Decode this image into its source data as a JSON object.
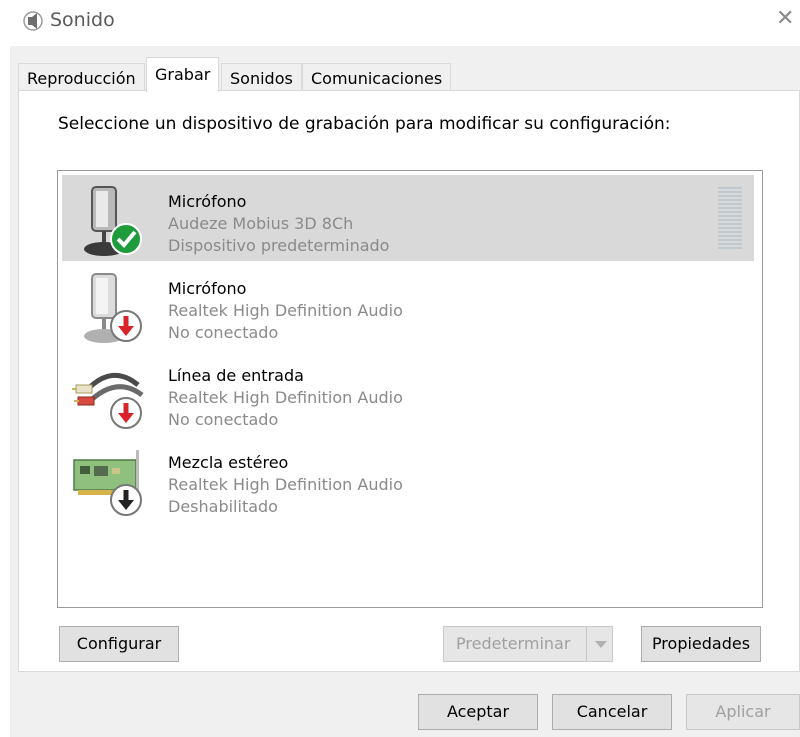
{
  "window": {
    "title": "Sonido",
    "icon": "speaker-icon",
    "close_icon": "close-icon"
  },
  "tabs": [
    {
      "label": "Reproducción",
      "active": false
    },
    {
      "label": "Grabar",
      "active": true
    },
    {
      "label": "Sonidos",
      "active": false
    },
    {
      "label": "Comunicaciones",
      "active": false
    }
  ],
  "instruction": "Seleccione un dispositivo de grabación para modificar su configuración:",
  "devices": [
    {
      "name": "Micrófono",
      "driver": "Audeze Mobius 3D 8Ch",
      "status": "Dispositivo predeterminado",
      "icon": "microphone-icon",
      "badge": "default-check-icon",
      "selected": true
    },
    {
      "name": "Micrófono",
      "driver": "Realtek High Definition Audio",
      "status": "No conectado",
      "icon": "microphone-icon",
      "badge": "disconnected-arrow-icon",
      "selected": false
    },
    {
      "name": "Línea de entrada",
      "driver": "Realtek High Definition Audio",
      "status": "No conectado",
      "icon": "line-in-cable-icon",
      "badge": "disconnected-arrow-icon",
      "selected": false
    },
    {
      "name": "Mezcla estéreo",
      "driver": "Realtek High Definition Audio",
      "status": "Deshabilitado",
      "icon": "sound-card-icon",
      "badge": "disabled-arrow-icon",
      "selected": false
    }
  ],
  "buttons": {
    "configure": "Configurar",
    "set_default": "Predeterminar",
    "properties": "Propiedades",
    "ok": "Aceptar",
    "cancel": "Cancelar",
    "apply": "Aplicar"
  },
  "colors": {
    "default_badge": "#1e9b3a",
    "disconnected_badge": "#d8232a",
    "disabled_badge": "#222222",
    "selection": "#d9d9d9"
  }
}
